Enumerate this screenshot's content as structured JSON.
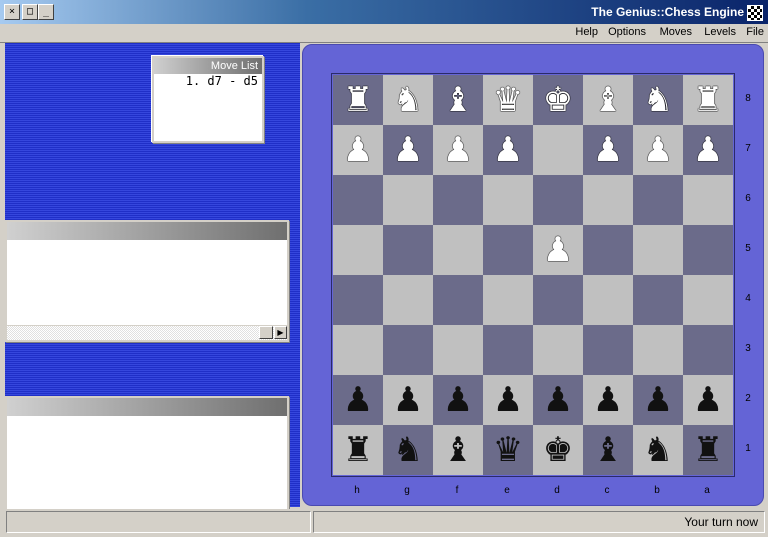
{
  "window": {
    "title": "The Genius::Chess Engine",
    "controls": {
      "close": "×",
      "maximize": "□",
      "minimize": "_"
    }
  },
  "menu": [
    "File",
    "Levels",
    "Moves",
    "Options",
    "Help"
  ],
  "move_list": {
    "title": "Move List",
    "moves": [
      "1. d7 - d5"
    ]
  },
  "board": {
    "files": [
      "h",
      "g",
      "f",
      "e",
      "d",
      "c",
      "b",
      "a"
    ],
    "ranks": [
      "8",
      "7",
      "6",
      "5",
      "4",
      "3",
      "2",
      "1"
    ],
    "light_square_color": "#c0c0c0",
    "dark_square_color": "#6b6b8a",
    "frame_color": "#6464d6",
    "pieces": [
      {
        "square": "h8",
        "type": "rook",
        "color": "white"
      },
      {
        "square": "g8",
        "type": "knight",
        "color": "white"
      },
      {
        "square": "f8",
        "type": "bishop",
        "color": "white"
      },
      {
        "square": "e8",
        "type": "queen",
        "color": "white"
      },
      {
        "square": "d8",
        "type": "king",
        "color": "white"
      },
      {
        "square": "c8",
        "type": "bishop",
        "color": "white"
      },
      {
        "square": "b8",
        "type": "knight",
        "color": "white"
      },
      {
        "square": "a8",
        "type": "rook",
        "color": "white"
      },
      {
        "square": "h7",
        "type": "pawn",
        "color": "white"
      },
      {
        "square": "g7",
        "type": "pawn",
        "color": "white"
      },
      {
        "square": "f7",
        "type": "pawn",
        "color": "white"
      },
      {
        "square": "e7",
        "type": "pawn",
        "color": "white"
      },
      {
        "square": "c7",
        "type": "pawn",
        "color": "white"
      },
      {
        "square": "b7",
        "type": "pawn",
        "color": "white"
      },
      {
        "square": "a7",
        "type": "pawn",
        "color": "white"
      },
      {
        "square": "d5",
        "type": "pawn",
        "color": "white"
      },
      {
        "square": "h2",
        "type": "pawn",
        "color": "black"
      },
      {
        "square": "g2",
        "type": "pawn",
        "color": "black"
      },
      {
        "square": "f2",
        "type": "pawn",
        "color": "black"
      },
      {
        "square": "e2",
        "type": "pawn",
        "color": "black"
      },
      {
        "square": "d2",
        "type": "pawn",
        "color": "black"
      },
      {
        "square": "c2",
        "type": "pawn",
        "color": "black"
      },
      {
        "square": "b2",
        "type": "pawn",
        "color": "black"
      },
      {
        "square": "a2",
        "type": "pawn",
        "color": "black"
      },
      {
        "square": "h1",
        "type": "rook",
        "color": "black"
      },
      {
        "square": "g1",
        "type": "knight",
        "color": "black"
      },
      {
        "square": "f1",
        "type": "bishop",
        "color": "black"
      },
      {
        "square": "e1",
        "type": "queen",
        "color": "black"
      },
      {
        "square": "d1",
        "type": "king",
        "color": "black"
      },
      {
        "square": "c1",
        "type": "bishop",
        "color": "black"
      },
      {
        "square": "b1",
        "type": "knight",
        "color": "black"
      },
      {
        "square": "a1",
        "type": "rook",
        "color": "black"
      }
    ]
  },
  "status": {
    "message": "Your turn now"
  },
  "colors": {
    "left_panel": "#2a3bd6",
    "titlebar_dark": "#0a246a"
  }
}
